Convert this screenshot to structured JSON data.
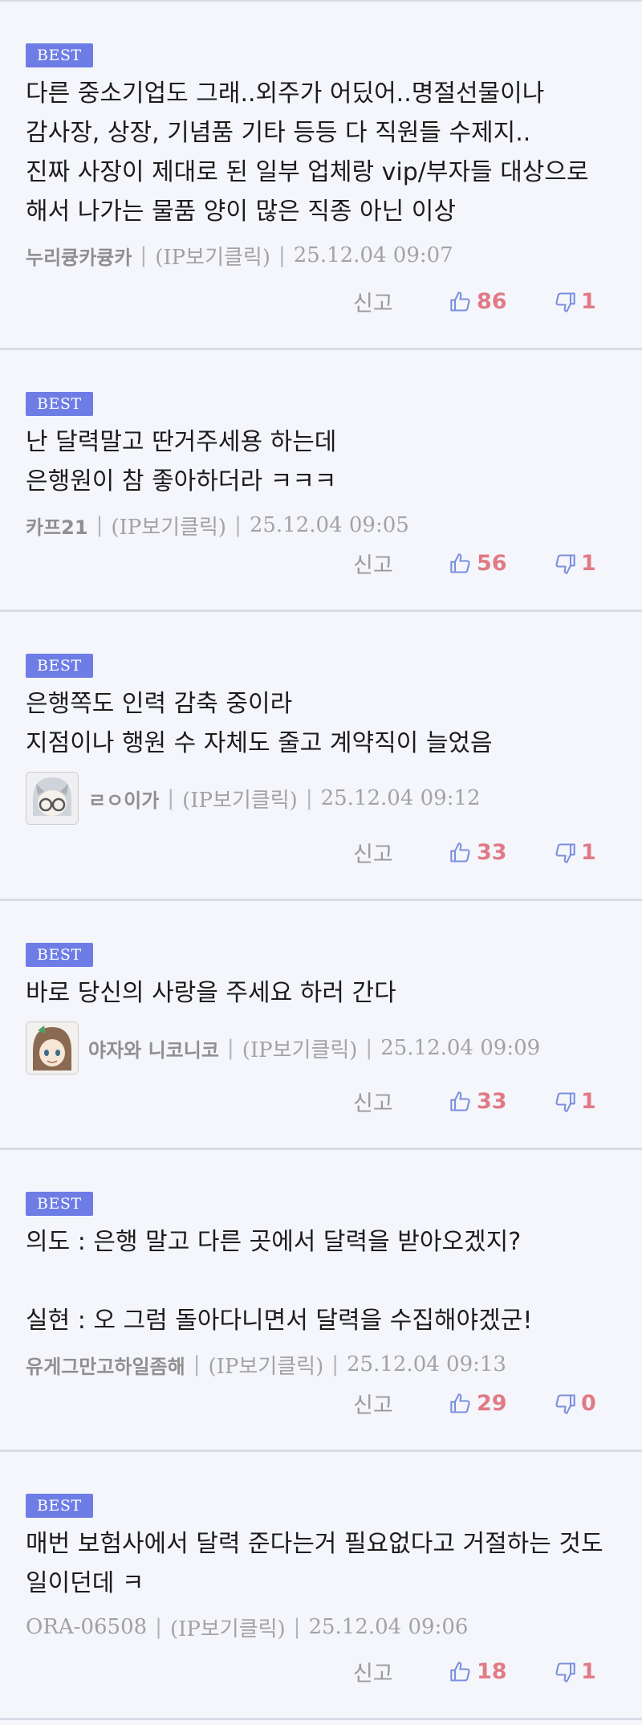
{
  "comments": [
    {
      "badge": "BEST",
      "text": "다른 중소기업도 그래..외주가 어딨어..명절선물이나 감사장, 상장, 기념품 기타 등등 다 직원들 수제지..\n진짜 사장이 제대로 된 일부 업체랑 vip/부자들 대상으로 해서 나가는 물품 양이 많은 직종 아닌 이상",
      "nick": "누리큥카큥카",
      "ip": "(IP보기클릭)",
      "time": "25.12.04 09:07",
      "report": "신고",
      "up": "86",
      "down": "1"
    },
    {
      "badge": "BEST",
      "text": "난 달력말고 딴거주세용 하는데\n은행원이 참 좋아하더라 ㅋㅋㅋ",
      "nick": "카프21",
      "ip": "(IP보기클릭)",
      "time": "25.12.04 09:05",
      "report": "신고",
      "up": "56",
      "down": "1"
    },
    {
      "badge": "BEST",
      "text": "은행쪽도 인력 감축 중이라\n지점이나 행원 수 자체도 줄고 계약직이 늘었음",
      "nick": "ㄹㅇ이가",
      "ip": "(IP보기클릭)",
      "time": "25.12.04 09:12",
      "report": "신고",
      "up": "33",
      "down": "1"
    },
    {
      "badge": "BEST",
      "text": "바로 당신의 사랑을 주세요 하러 간다",
      "nick": "야자와 니코니코",
      "ip": "(IP보기클릭)",
      "time": "25.12.04 09:09",
      "report": "신고",
      "up": "33",
      "down": "1"
    },
    {
      "badge": "BEST",
      "text": "의도 : 은행 말고 다른 곳에서 달력을 받아오겠지?\n\n실현 : 오 그럼 돌아다니면서 달력을 수집해야겠군!",
      "nick": "유게그만고하일좀해",
      "ip": "(IP보기클릭)",
      "time": "25.12.04 09:13",
      "report": "신고",
      "up": "29",
      "down": "0"
    },
    {
      "badge": "BEST",
      "text": "매번 보험사에서 달력 준다는거 필요없다고 거절하는 것도 일이던데 ㅋ",
      "nick": "ORA-06508",
      "ip": "(IP보기클릭)",
      "time": "25.12.04 09:06",
      "report": "신고",
      "up": "18",
      "down": "1"
    }
  ],
  "colors": {
    "badge": "#6e7de6",
    "vote_count": "#e07b86",
    "vote_icon": "#7b8fe0",
    "background": "#f5f6fb"
  }
}
